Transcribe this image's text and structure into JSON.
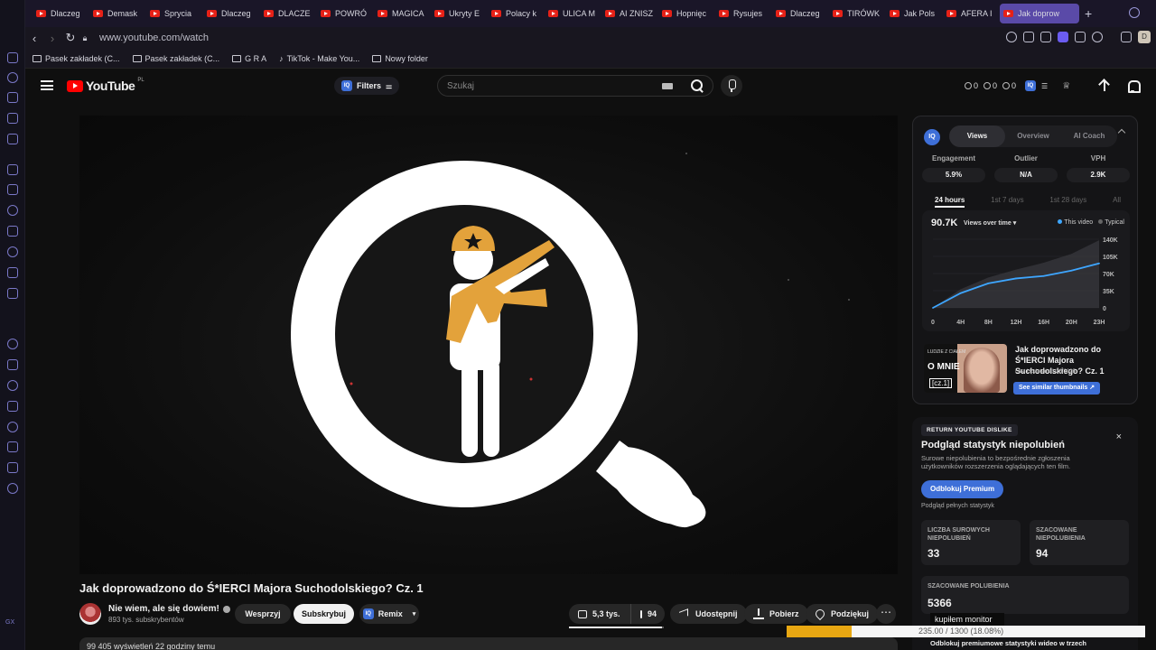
{
  "browser": {
    "tabs": [
      "Dlaczeg",
      "Demask",
      "Sprycia",
      "Dlaczeg",
      "DLACZE",
      "POWRÓ",
      "MAGICA",
      "Ukryty E",
      "Polacy k",
      "ULICA M",
      "AI ZNISZ",
      "Hopnięc",
      "Rysujes",
      "Dlaczeg",
      "TIRÓWK",
      "Jak Pols",
      "AFERA I"
    ],
    "active_tab": "Jak doprow",
    "url": "www.youtube.com/watch",
    "profile_letter": "D",
    "bookmarks": [
      "Pasek zakładek (C...",
      "Pasek zakładek (C...",
      "G R A",
      "TikTok - Make You...",
      "Nowy folder"
    ],
    "rail_bottom_label": "GX"
  },
  "header": {
    "logo_text": "YouTube",
    "logo_region": "PL",
    "filters_label": "Filters",
    "search_placeholder": "Szukaj",
    "counters": [
      "0",
      "0",
      "0"
    ],
    "iq_label": "IQ"
  },
  "video": {
    "title": "Jak doprowadzono do Ś*IERCI Majora Suchodolskiego? Cz. 1",
    "channel_name": "Nie wiem, ale się dowiem!",
    "subscribers": "893 tys. subskrybentów",
    "support_label": "Wesprzyj",
    "subscribe_label": "Subskrybuj",
    "remix_label": "Remix",
    "likes": "5,3 tys.",
    "dislikes": "94",
    "share_label": "Udostępnij",
    "download_label": "Pobierz",
    "thanks_label": "Podziękuj",
    "more_label": "⋯",
    "like_ratio": 0.98,
    "description_preview": "99 405 wyświetleń  22 godziny temu"
  },
  "iq_panel": {
    "logo": "IQ",
    "tabs": [
      "Views",
      "Overview",
      "AI Coach"
    ],
    "active_tab": "Views",
    "metrics": [
      {
        "label": "Engagement",
        "value": "5.9%"
      },
      {
        "label": "Outlier",
        "value": "N/A"
      },
      {
        "label": "VPH",
        "value": "2.9K"
      }
    ],
    "periods": [
      "24 hours",
      "1st 7 days",
      "1st 28 days",
      "All"
    ],
    "active_period": "24 hours",
    "total_views": "90.7K",
    "dropdown_label": "Views over time",
    "legend": [
      "This video",
      "Typical"
    ],
    "chart_data": {
      "type": "area",
      "x": [
        "0",
        "4H",
        "8H",
        "12H",
        "16H",
        "20H",
        "23H"
      ],
      "series": [
        {
          "name": "This video",
          "values": [
            0,
            30000,
            50000,
            60000,
            65000,
            76000,
            90700
          ]
        },
        {
          "name": "Typical",
          "values": [
            0,
            38000,
            62000,
            78000,
            92000,
            110000,
            138000
          ]
        }
      ],
      "y_ticks": [
        "140K",
        "105K",
        "70K",
        "35K",
        "0"
      ],
      "ylim": [
        0,
        140000
      ],
      "colors": {
        "this_video": "#3ea6ff",
        "typical": "#555555"
      }
    },
    "thumbnail": {
      "top_text": "LUDZIE Z CIAŁEM",
      "line1": "O MNIE",
      "line2": "[cz.1]",
      "title": "Jak doprowadzono do Ś*IERCI Majora Suchodolskiego? Cz. 1",
      "updated": "Last Updated 11/28/2025",
      "button": "See similar thumbnails"
    }
  },
  "dislike_panel": {
    "tag": "RETURN YOUTUBE DISLIKE",
    "close": "×",
    "title": "Podgląd statystyk niepolubień",
    "subtitle": "Surowe niepolubienia to bezpośrednie zgłoszenia użytkowników rozszerzenia oglądających ten film.",
    "premium_button": "Odblokuj Premium",
    "premium_note": "Podgląd pełnych statystyk",
    "stats": [
      {
        "label": "LICZBA SUROWYCH NIEPOLUBIEŃ",
        "value": "33"
      },
      {
        "label": "SZACOWANE NIEPOLUBIENIA",
        "value": "94"
      },
      {
        "label": "SZACOWANE POLUBIENIA",
        "value": "5366"
      }
    ],
    "bottom_text": "Odblokuj premiumowe statystyki wideo w trzech"
  },
  "overlay": {
    "monitor_text": "kupiłem monitor",
    "progress_text": "235.00 / 1300 (18.08%)",
    "progress_fraction": 0.1808,
    "progress_color": "#e8a712"
  }
}
